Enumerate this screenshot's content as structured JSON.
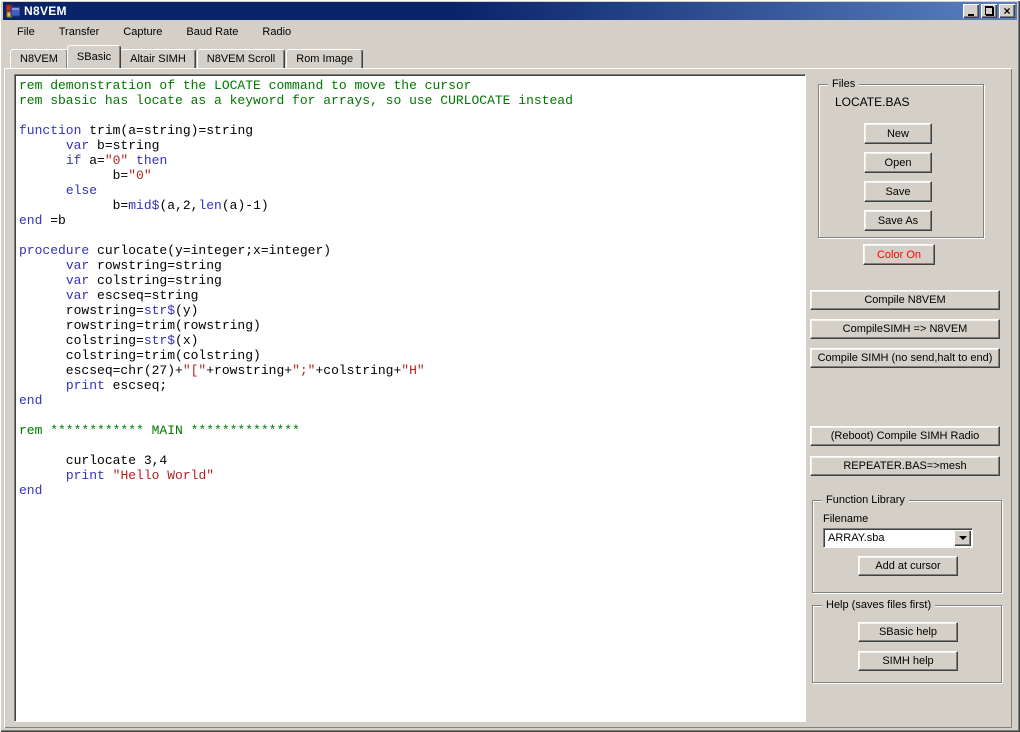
{
  "window": {
    "title": "N8VEM"
  },
  "menu": {
    "items": [
      "File",
      "Transfer",
      "Capture",
      "Baud Rate",
      "Radio"
    ]
  },
  "tabs": [
    {
      "label": "N8VEM",
      "active": false
    },
    {
      "label": "SBasic",
      "active": true
    },
    {
      "label": "Altair SIMH",
      "active": false
    },
    {
      "label": "N8VEM Scroll",
      "active": false
    },
    {
      "label": "Rom Image",
      "active": false
    }
  ],
  "editor": {
    "lines": [
      [
        [
          "c",
          "rem demonstration of the LOCATE command to move the cursor"
        ]
      ],
      [
        [
          "c",
          "rem sbasic has locate as a keyword for arrays, so use CURLOCATE instead"
        ]
      ],
      [],
      [
        [
          "k",
          "function"
        ],
        [
          "p",
          " trim(a=string)=string"
        ]
      ],
      [
        [
          "p",
          "      "
        ],
        [
          "k",
          "var"
        ],
        [
          "p",
          " b=string"
        ]
      ],
      [
        [
          "p",
          "      "
        ],
        [
          "k",
          "if"
        ],
        [
          "p",
          " a="
        ],
        [
          "s",
          "\"0\""
        ],
        [
          "p",
          " "
        ],
        [
          "k",
          "then"
        ]
      ],
      [
        [
          "p",
          "            b="
        ],
        [
          "s",
          "\"0\""
        ]
      ],
      [
        [
          "p",
          "      "
        ],
        [
          "k",
          "else"
        ]
      ],
      [
        [
          "p",
          "            b="
        ],
        [
          "k",
          "mid$"
        ],
        [
          "p",
          "(a,2,"
        ],
        [
          "k",
          "len"
        ],
        [
          "p",
          "(a)-1)"
        ]
      ],
      [
        [
          "k",
          "end"
        ],
        [
          "p",
          " =b"
        ]
      ],
      [],
      [
        [
          "k",
          "procedure"
        ],
        [
          "p",
          " curlocate(y=integer;x=integer)"
        ]
      ],
      [
        [
          "p",
          "      "
        ],
        [
          "k",
          "var"
        ],
        [
          "p",
          " rowstring=string"
        ]
      ],
      [
        [
          "p",
          "      "
        ],
        [
          "k",
          "var"
        ],
        [
          "p",
          " colstring=string"
        ]
      ],
      [
        [
          "p",
          "      "
        ],
        [
          "k",
          "var"
        ],
        [
          "p",
          " escseq=string"
        ]
      ],
      [
        [
          "p",
          "      rowstring="
        ],
        [
          "k",
          "str$"
        ],
        [
          "p",
          "(y)"
        ]
      ],
      [
        [
          "p",
          "      rowstring=trim(rowstring)"
        ]
      ],
      [
        [
          "p",
          "      colstring="
        ],
        [
          "k",
          "str$"
        ],
        [
          "p",
          "(x)"
        ]
      ],
      [
        [
          "p",
          "      colstring=trim(colstring)"
        ]
      ],
      [
        [
          "p",
          "      escseq=chr(27)+"
        ],
        [
          "s",
          "\"[\""
        ],
        [
          "p",
          "+rowstring+"
        ],
        [
          "s",
          "\";\""
        ],
        [
          "p",
          "+colstring+"
        ],
        [
          "s",
          "\"H\""
        ]
      ],
      [
        [
          "p",
          "      "
        ],
        [
          "k",
          "print"
        ],
        [
          "p",
          " escseq;"
        ]
      ],
      [
        [
          "k",
          "end"
        ]
      ],
      [],
      [
        [
          "c",
          "rem ************ MAIN **************"
        ]
      ],
      [],
      [
        [
          "p",
          "      curlocate 3,4"
        ]
      ],
      [
        [
          "p",
          "      "
        ],
        [
          "k",
          "print"
        ],
        [
          "p",
          " "
        ],
        [
          "s",
          "\"Hello World\""
        ]
      ],
      [
        [
          "k",
          "end"
        ]
      ]
    ]
  },
  "files": {
    "title": "Files",
    "filename": "LOCATE.BAS",
    "buttons": [
      "New",
      "Open",
      "Save",
      "Save As"
    ]
  },
  "color_button": {
    "label": "Color On"
  },
  "compile_buttons": [
    "Compile N8VEM",
    "CompileSIMH => N8VEM",
    "Compile SIMH (no send,halt to end)"
  ],
  "radio_buttons": [
    "(Reboot) Compile SIMH Radio",
    "REPEATER.BAS=>mesh"
  ],
  "function_library": {
    "title": "Function Library",
    "filename_label": "Filename",
    "combo_value": "ARRAY.sba",
    "button_label": "Add at cursor"
  },
  "help": {
    "title": "Help (saves files first)",
    "buttons": [
      "SBasic help",
      "SIMH help"
    ]
  },
  "colors": {
    "chrome": "#d4d0c8",
    "titlebar_start": "#0a246a",
    "titlebar_end": "#5a82c0",
    "keyword": "#3333bb",
    "comment": "#007700",
    "string": "#b22222",
    "color_on_text": "#ff0000"
  }
}
